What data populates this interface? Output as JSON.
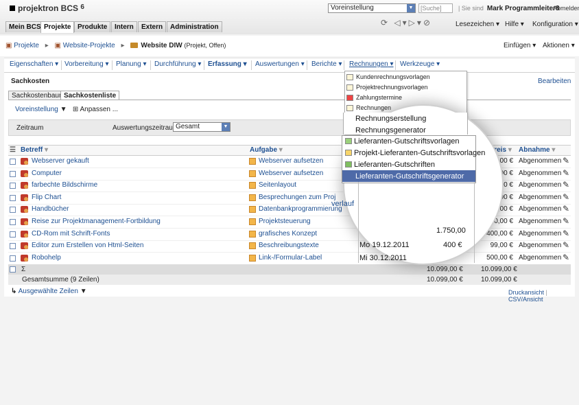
{
  "app": {
    "brand": "projektron BCS",
    "version": "6"
  },
  "topbar": {
    "preset": "Voreinstellung",
    "search_placeholder": "Suche",
    "you_are": "Sie sind",
    "user_name": "Mark Programmleiter8",
    "logout": "Abmelden"
  },
  "main_tabs": [
    {
      "label": "Mein BCS"
    },
    {
      "label": "Projekte"
    },
    {
      "label": "Produkte"
    },
    {
      "label": "Intern"
    },
    {
      "label": "Extern"
    },
    {
      "label": "Administration"
    }
  ],
  "top_menus": {
    "bookmarks": "Lesezeichen",
    "help": "Hilfe",
    "config": "Konfiguration"
  },
  "breadcrumb": {
    "projects": "Projekte",
    "web_projects": "Website-Projekte",
    "current": "Website DIW",
    "status": "(Projekt, Offen)"
  },
  "actions": {
    "insert": "Einfügen",
    "actions": "Aktionen"
  },
  "nav": [
    "Eigenschaften",
    "Vorbereitung",
    "Planung",
    "Durchführung",
    "Erfassung",
    "Auswertungen",
    "Berichte",
    "Rechnungen",
    "Werkzeuge"
  ],
  "section": {
    "title": "Sachkosten",
    "edit": "Bearbeiten"
  },
  "view_tabs": [
    "Sachkostenbaum",
    "Sachkostenliste"
  ],
  "toolbar": {
    "preset": "Voreinstellung",
    "customize": "Anpassen ..."
  },
  "filter": {
    "label": "Zeitraum",
    "range_label": "Auswertungszeitraum:",
    "range_value": "Gesamt"
  },
  "table": {
    "headers": {
      "item": "Betreff",
      "task": "Aufgabe",
      "price": "kaufspreis",
      "accept": "Abnahme"
    },
    "rows": [
      {
        "item": "Webserver gekauft",
        "task": "Webserver aufsetzen",
        "price": "6.000,00 €",
        "accept": "Abgenommen"
      },
      {
        "item": "Computer",
        "task": "Webserver aufsetzen",
        "price": "550,00 €",
        "accept": "Abgenommen"
      },
      {
        "item": "farbechte Bildschirme",
        "task": "Seitenlayout",
        "price": "500,00 €",
        "accept": "Abgenommen"
      },
      {
        "item": "Flip Chart",
        "task": "Besprechungen zum Proj",
        "price": "150,00 €",
        "accept": "Abgenommen"
      },
      {
        "item": "Handbücher",
        "task": "Datenbankprogrammierung",
        "price": "150,00 €",
        "accept": "Abgenommen"
      },
      {
        "item": "Reise zur Projektmanagement-Fortbildung",
        "task": "Projektsteuerung",
        "price": "1.750,00 €",
        "accept": "Abgenommen"
      },
      {
        "item": "CD-Rom mit Schrift-Fonts",
        "task": "grafisches Konzept",
        "price": "400,00 €",
        "accept": "Abgenommen"
      },
      {
        "item": "Editor zum Erstellen von Html-Seiten",
        "task": "Beschreibungstexte",
        "price": "99,00 €",
        "accept": "Abgenommen"
      },
      {
        "item": "Robohelp",
        "task": "Link-/Formular-Label",
        "price": "500,00 €",
        "accept": "Abgenommen"
      }
    ],
    "sum_symbol": "Σ",
    "sum_a": "10.099,00 €",
    "sum_b": "10.099,00 €",
    "total_label": "Gesamtsumme (9 Zeilen)",
    "total_a": "10.099,00 €",
    "total_b": "10.099,00 €"
  },
  "bottom": {
    "selected": "Ausgewählte Zeilen",
    "print": "Druckansicht",
    "csv": "CSV/Ansicht"
  },
  "invoice_menu": [
    "Kundenrechnungsvorlagen",
    "Projektrechnungsvorlagen",
    "Zahlungstermine",
    "Rechnungen"
  ],
  "lens": {
    "menu": [
      "Rechnungserstellung",
      "Rechnungsgenerator",
      "Lieferanten-Gutschriftsvorlagen",
      "Projekt-Lieferanten-Gutschriftsvorlagen",
      "Lieferanten-Gutschriften",
      "Lieferanten-Gutschriftsgenerator"
    ],
    "verlauf": "verlauf",
    "amount": "1.750,00",
    "amount2": "400 €",
    "date1": "Mo 19.12.2011",
    "date2": "Mi 30.12.2011"
  }
}
